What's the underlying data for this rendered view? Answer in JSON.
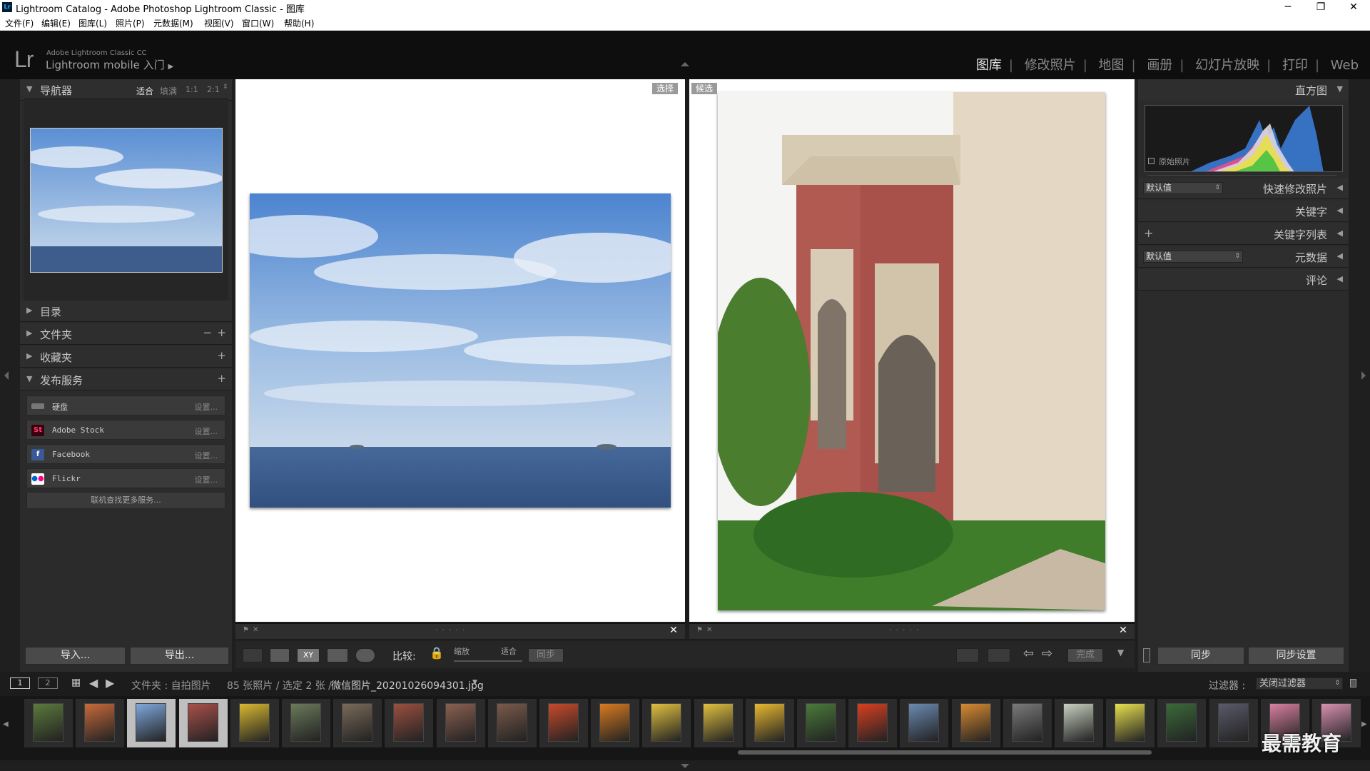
{
  "window": {
    "title": "Lightroom Catalog - Adobe Photoshop Lightroom Classic - 图库",
    "app_icon": "Lr"
  },
  "menu": [
    "文件(F)",
    "编辑(E)",
    "图库(L)",
    "照片(P)",
    "元数据(M)",
    "视图(V)",
    "窗口(W)",
    "帮助(H)"
  ],
  "identity": {
    "logo": "Lr",
    "product": "Adobe Lightroom Classic CC",
    "mobile": "Lightroom mobile 入门",
    "arrow": "▶"
  },
  "modules": {
    "library": "图库",
    "develop": "修改照片",
    "map": "地图",
    "book": "画册",
    "slideshow": "幻灯片放映",
    "print": "打印",
    "web": "Web",
    "separator": "|"
  },
  "left": {
    "navigator": {
      "title": "导航器",
      "fit": "适合",
      "fill": "填满",
      "r11": "1:1",
      "r21": "2:1"
    },
    "catalog": "目录",
    "folders": "文件夹",
    "collections": "收藏夹",
    "publish": "发布服务",
    "services": [
      {
        "name": "硬盘",
        "setup": "设置..."
      },
      {
        "name": "Adobe Stock",
        "setup": "设置..."
      },
      {
        "name": "Facebook",
        "setup": "设置..."
      },
      {
        "name": "Flickr",
        "setup": "设置..."
      }
    ],
    "more_services": "联机查找更多服务...",
    "import": "导入...",
    "export": "导出..."
  },
  "compare": {
    "select_tag": "选择",
    "candidate_tag": "候选"
  },
  "toolbar": {
    "compare_label": "比较:",
    "zoom_label": "缩放",
    "fit_label": "适合",
    "sync": "同步",
    "done": "完成"
  },
  "right": {
    "histogram": "直方图",
    "original_photo": "原始照片",
    "quick_develop": "快速修改照片",
    "quick_preset": "默认值",
    "keywording": "关键字",
    "keyword_list": "关键字列表",
    "metadata": "元数据",
    "metadata_preset": "默认值",
    "comments": "评论",
    "sync": "同步",
    "sync_settings": "同步设置"
  },
  "filmstrip_bar": {
    "page1": "1",
    "page2": "2",
    "source": "文件夹 : 自拍图片",
    "count": "85 张照片 / 选定 2 张 /",
    "filename": "微信图片_20201026094301.jpg",
    "filter_label": "过滤器 :",
    "filter_value": "关闭过滤器"
  },
  "watermark": "最需教育",
  "colors": {
    "bg": "#1f1f1f",
    "panel": "#2b2b2b",
    "active_module": "#e6e6e6",
    "sky": "#7fa8dc",
    "sea": "#3e5d8c",
    "brick": "#a8504a"
  }
}
